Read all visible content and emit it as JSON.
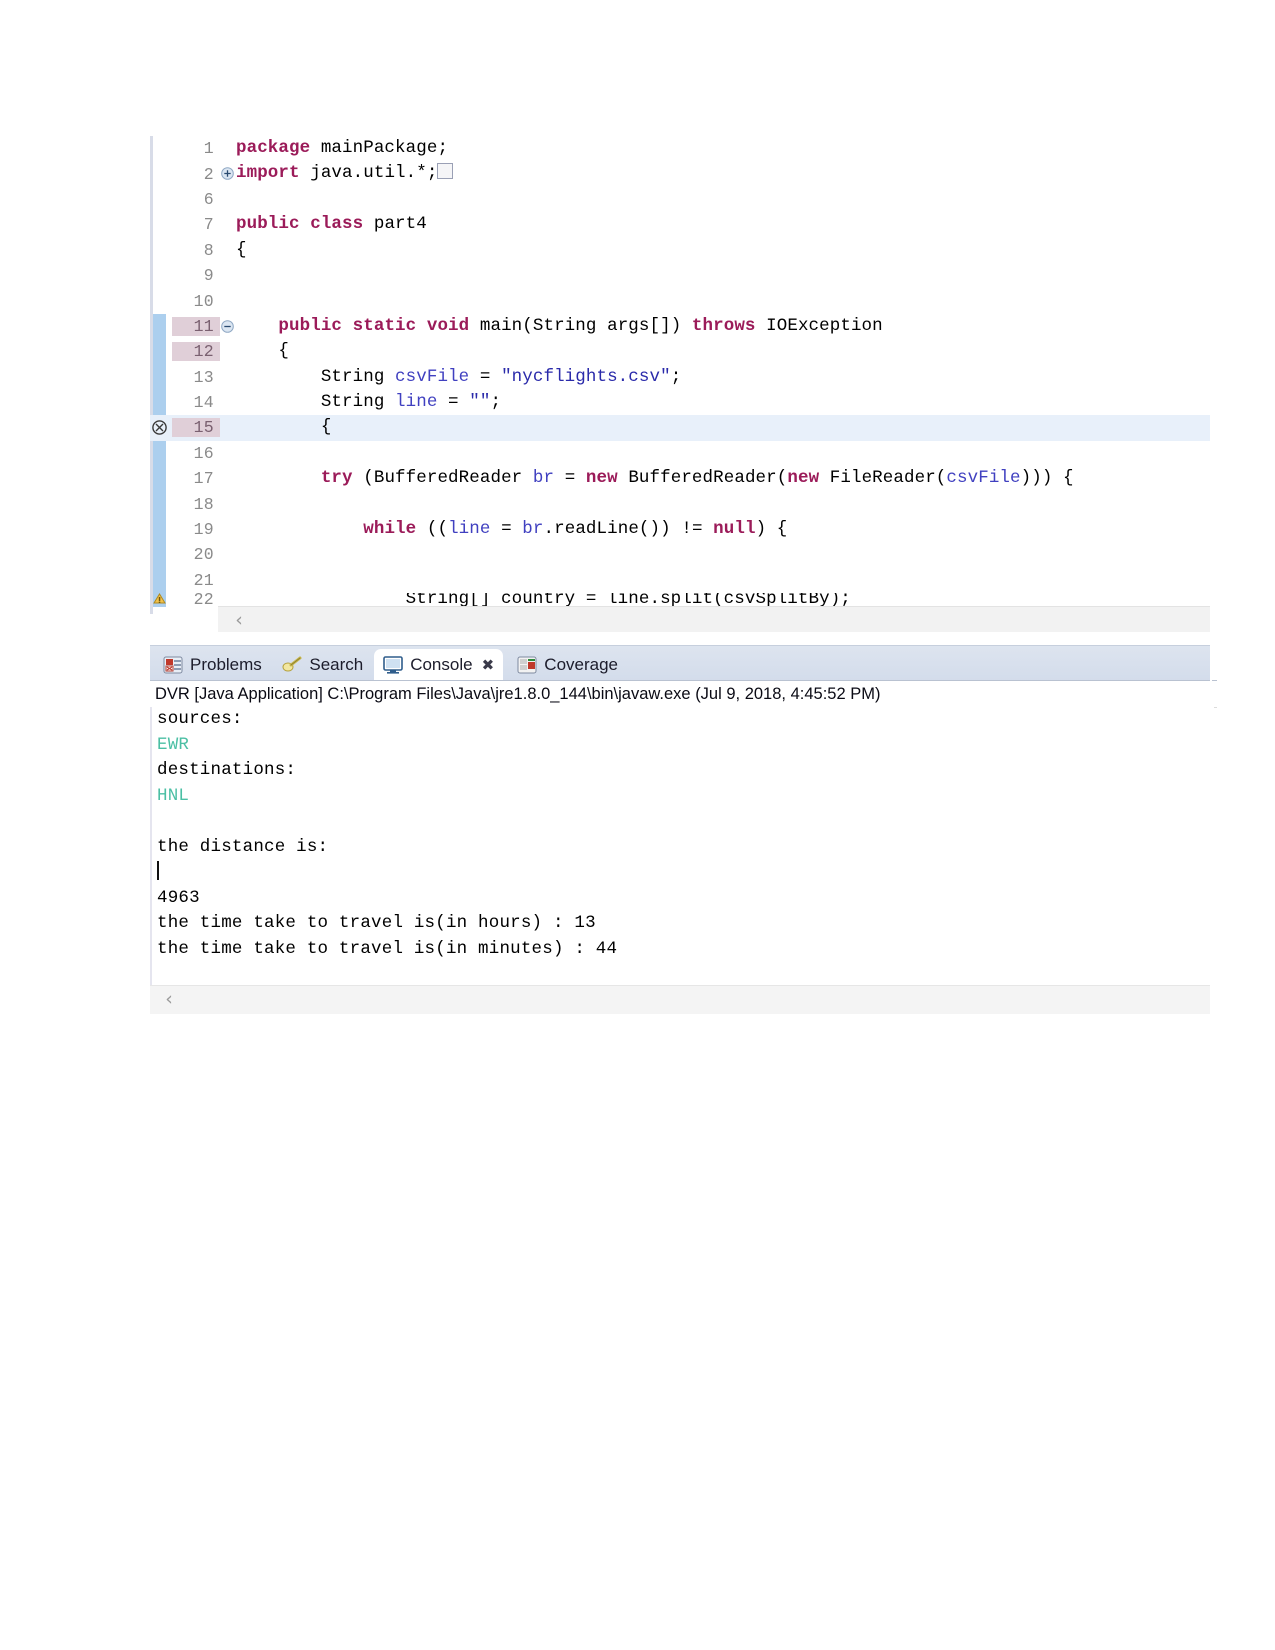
{
  "editor": {
    "name": "java-source-editor",
    "lines": [
      {
        "num": "1",
        "marker": "",
        "fold": "",
        "stripe": false,
        "current": false,
        "highlight": false,
        "tokens": [
          {
            "t": "kw",
            "v": "package"
          },
          {
            "t": "plain",
            "v": " mainPackage;"
          }
        ]
      },
      {
        "num": "2",
        "marker": "",
        "fold": "expand",
        "stripe": false,
        "current": false,
        "highlight": false,
        "tokens": [
          {
            "t": "kw",
            "v": "import"
          },
          {
            "t": "plain",
            "v": " java.util.*;"
          },
          {
            "t": "foldbox",
            "v": ""
          }
        ]
      },
      {
        "num": "6",
        "marker": "",
        "fold": "",
        "stripe": false,
        "current": false,
        "highlight": false,
        "tokens": []
      },
      {
        "num": "7",
        "marker": "",
        "fold": "",
        "stripe": false,
        "current": false,
        "highlight": false,
        "tokens": [
          {
            "t": "kw",
            "v": "public class"
          },
          {
            "t": "plain",
            "v": " part4"
          }
        ]
      },
      {
        "num": "8",
        "marker": "",
        "fold": "",
        "stripe": false,
        "current": false,
        "highlight": false,
        "tokens": [
          {
            "t": "plain",
            "v": "{"
          }
        ]
      },
      {
        "num": "9",
        "marker": "",
        "fold": "",
        "stripe": false,
        "current": false,
        "highlight": false,
        "tokens": []
      },
      {
        "num": "10",
        "marker": "",
        "fold": "",
        "stripe": false,
        "current": false,
        "highlight": false,
        "tokens": []
      },
      {
        "num": "11",
        "marker": "",
        "fold": "collapse",
        "stripe": true,
        "current": true,
        "highlight": false,
        "tokens": [
          {
            "t": "plain",
            "v": "    "
          },
          {
            "t": "kw",
            "v": "public static void"
          },
          {
            "t": "plain",
            "v": " main(String args[]) "
          },
          {
            "t": "kw",
            "v": "throws"
          },
          {
            "t": "plain",
            "v": " IOException"
          }
        ]
      },
      {
        "num": "12",
        "marker": "",
        "fold": "",
        "stripe": true,
        "current": true,
        "highlight": false,
        "tokens": [
          {
            "t": "plain",
            "v": "    {"
          }
        ]
      },
      {
        "num": "13",
        "marker": "",
        "fold": "",
        "stripe": true,
        "current": false,
        "highlight": false,
        "tokens": [
          {
            "t": "plain",
            "v": "        String "
          },
          {
            "t": "loc",
            "v": "csvFile"
          },
          {
            "t": "plain",
            "v": " = "
          },
          {
            "t": "str",
            "v": "\"nycflights.csv\""
          },
          {
            "t": "plain",
            "v": ";"
          }
        ]
      },
      {
        "num": "14",
        "marker": "",
        "fold": "",
        "stripe": true,
        "current": false,
        "highlight": false,
        "tokens": [
          {
            "t": "plain",
            "v": "        String "
          },
          {
            "t": "loc",
            "v": "line"
          },
          {
            "t": "plain",
            "v": " = "
          },
          {
            "t": "str",
            "v": "\"\""
          },
          {
            "t": "plain",
            "v": ";"
          }
        ]
      },
      {
        "num": "15",
        "marker": "error",
        "fold": "",
        "stripe": false,
        "current": true,
        "highlight": true,
        "tokens": [
          {
            "t": "plain",
            "v": "        {"
          }
        ]
      },
      {
        "num": "16",
        "marker": "",
        "fold": "",
        "stripe": true,
        "current": false,
        "highlight": false,
        "tokens": []
      },
      {
        "num": "17",
        "marker": "",
        "fold": "",
        "stripe": true,
        "current": false,
        "highlight": false,
        "tokens": [
          {
            "t": "plain",
            "v": "        "
          },
          {
            "t": "kw",
            "v": "try"
          },
          {
            "t": "plain",
            "v": " (BufferedReader "
          },
          {
            "t": "loc",
            "v": "br"
          },
          {
            "t": "plain",
            "v": " = "
          },
          {
            "t": "kw",
            "v": "new"
          },
          {
            "t": "plain",
            "v": " BufferedReader("
          },
          {
            "t": "kw",
            "v": "new"
          },
          {
            "t": "plain",
            "v": " FileReader("
          },
          {
            "t": "loc",
            "v": "csvFile"
          },
          {
            "t": "plain",
            "v": "))) {"
          }
        ]
      },
      {
        "num": "18",
        "marker": "",
        "fold": "",
        "stripe": true,
        "current": false,
        "highlight": false,
        "tokens": []
      },
      {
        "num": "19",
        "marker": "",
        "fold": "",
        "stripe": true,
        "current": false,
        "highlight": false,
        "tokens": [
          {
            "t": "plain",
            "v": "            "
          },
          {
            "t": "kw",
            "v": "while"
          },
          {
            "t": "plain",
            "v": " (("
          },
          {
            "t": "loc",
            "v": "line"
          },
          {
            "t": "plain",
            "v": " = "
          },
          {
            "t": "loc",
            "v": "br"
          },
          {
            "t": "plain",
            "v": ".readLine()) != "
          },
          {
            "t": "kw",
            "v": "null"
          },
          {
            "t": "plain",
            "v": ") {"
          }
        ]
      },
      {
        "num": "20",
        "marker": "",
        "fold": "",
        "stripe": true,
        "current": false,
        "highlight": false,
        "tokens": []
      },
      {
        "num": "21",
        "marker": "",
        "fold": "",
        "stripe": true,
        "current": false,
        "highlight": false,
        "tokens": []
      },
      {
        "num": "22",
        "marker": "warning",
        "fold": "",
        "stripe": true,
        "current": false,
        "highlight": false,
        "clipped": true,
        "tokens": [
          {
            "t": "plain",
            "v": "                String[] country = line.split(csvSplitBy);"
          }
        ]
      }
    ],
    "hscroll_arrow": "‹"
  },
  "bottom_view": {
    "tabs": [
      {
        "label": "Problems",
        "icon": "problems-icon",
        "active": false,
        "closable": false
      },
      {
        "label": "Search",
        "icon": "search-icon",
        "active": false,
        "closable": false
      },
      {
        "label": "Console",
        "icon": "console-icon",
        "active": true,
        "closable": true,
        "close_glyph": "✖"
      },
      {
        "label": "Coverage",
        "icon": "coverage-icon",
        "active": false,
        "closable": false
      }
    ],
    "console_header": "DVR [Java Application] C:\\Program Files\\Java\\jre1.8.0_144\\bin\\javaw.exe (Jul 9, 2018, 4:45:52 PM)",
    "output_lines": [
      {
        "text": "sources:",
        "kind": "out"
      },
      {
        "text": "EWR",
        "kind": "input"
      },
      {
        "text": "destinations:",
        "kind": "out"
      },
      {
        "text": "HNL",
        "kind": "input"
      },
      {
        "text": "",
        "kind": "blank"
      },
      {
        "text": "the distance is:",
        "kind": "out"
      },
      {
        "text": "",
        "kind": "caret"
      },
      {
        "text": "4963",
        "kind": "out"
      },
      {
        "text": "the time take to travel is(in hours) : 13",
        "kind": "out"
      },
      {
        "text": "the time take to travel is(in minutes) : 44",
        "kind": "out"
      }
    ],
    "hscroll_arrow": "‹"
  },
  "colors": {
    "keyword": "#9b1b59",
    "string": "#2a2aaa",
    "local_var": "#4040c0",
    "console_input": "#4bbfa4",
    "gutter_stripe": "#a8cced",
    "current_line_num_bg": "#e0cfd8",
    "selected_line_bg": "#e8f0fa",
    "tabbar_bg": "#d3dceb"
  }
}
